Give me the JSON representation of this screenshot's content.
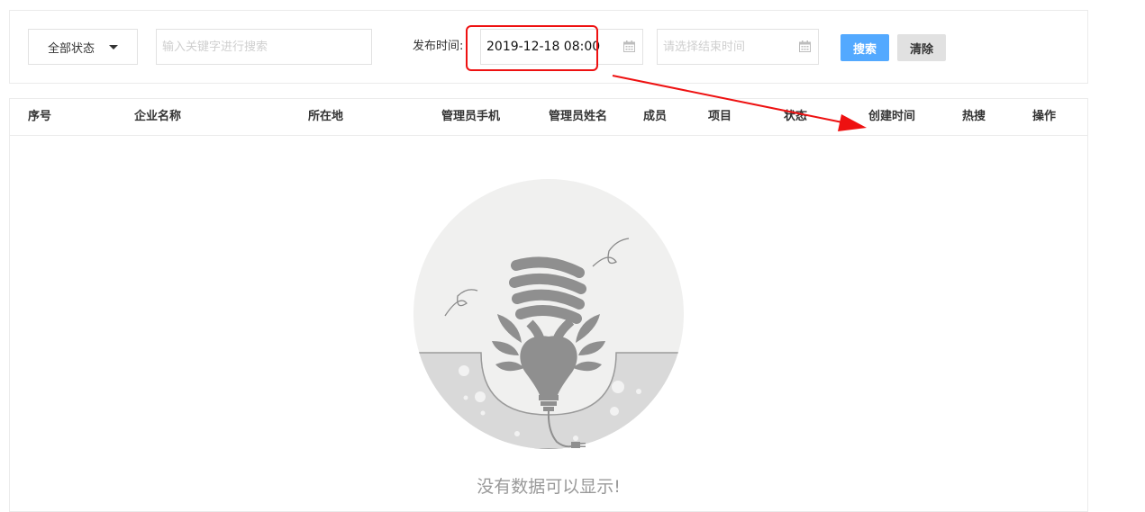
{
  "filters": {
    "status_select": {
      "value": "全部状态",
      "icon": "caret-down-icon"
    },
    "keyword": {
      "value": "",
      "placeholder": "输入关键字进行搜索"
    },
    "date_label": "发布时间:",
    "start_date": {
      "value": "2019-12-18 08:00",
      "icon": "calendar-icon"
    },
    "end_date": {
      "value": "",
      "placeholder": "请选择结束时间",
      "icon": "calendar-icon"
    },
    "search_button": "搜索",
    "clear_button": "清除"
  },
  "table": {
    "columns": [
      "序号",
      "企业名称",
      "所在地",
      "管理员手机",
      "管理员姓名",
      "成员",
      "项目",
      "状态",
      "创建时间",
      "热搜",
      "操作"
    ],
    "rows": [],
    "empty_message": "没有数据可以显示!",
    "empty_icon": "lightbulb-empty-illustration"
  },
  "annotations": {
    "highlight_color": "#ee1111",
    "arrow_color": "#ee1111"
  },
  "colors": {
    "primary_button": "#53a9ff",
    "secondary_button": "#e1e1e1",
    "border": "#e2e2e2"
  }
}
